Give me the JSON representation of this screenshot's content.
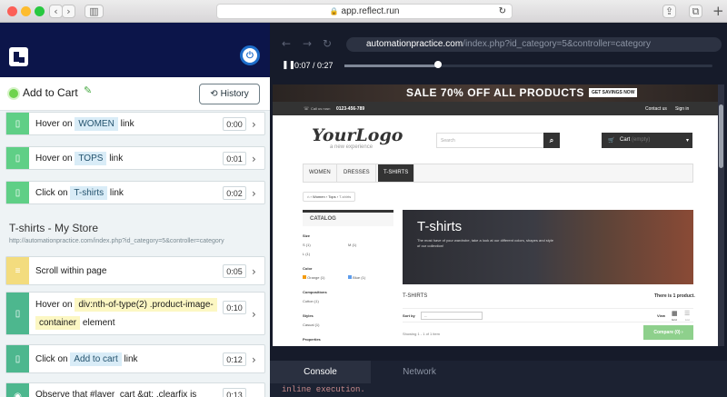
{
  "browser": {
    "address": "app.reflect.run"
  },
  "left": {
    "title": "Add to Cart",
    "history_label": "History",
    "steps": [
      {
        "pre": "Hover on",
        "tag": "WOMEN",
        "post": "link",
        "time": "0:00"
      },
      {
        "pre": "Hover on",
        "tag": "TOPS",
        "post": "link",
        "time": "0:01"
      },
      {
        "pre": "Click on",
        "tag": "T-shirts",
        "post": "link",
        "time": "0:02"
      }
    ],
    "page_title": "T-shirts - My Store",
    "page_url": "http://automationpractice.com/index.php?id_category=5&controller=category",
    "steps2": [
      {
        "text": "Scroll within page",
        "time": "0:05"
      },
      {
        "pre": "Hover on",
        "tag": "div:nth-of-type(2) .product-image-",
        "tag2": "container",
        "post": "element",
        "time": "0:10"
      },
      {
        "pre": "Click on",
        "tag": "Add to cart",
        "post": "link",
        "time": "0:12"
      },
      {
        "text": "Observe that #layer_cart &gt; .clearfix is",
        "time": "0:13"
      }
    ]
  },
  "right": {
    "url_host": "automationpractice.com",
    "url_path": "/index.php?id_category=5&controller=category",
    "time": "0:07 / 0:27",
    "progress": 0.26,
    "site": {
      "banner": "SALE 70% OFF ALL PRODUCTS",
      "banner_btn": "GET SAVINGS NOW",
      "call": "Call us now:",
      "phone": "0123-456-789",
      "contact": "Contact us",
      "signin": "Sign in",
      "logo": "YourLogo",
      "logo_sub": "a new experience",
      "search_ph": "Search",
      "cart": "Cart",
      "cart_empty": "(empty)",
      "menu": [
        "WOMEN",
        "DRESSES",
        "T-SHIRTS"
      ],
      "breadcrumb": [
        "Women",
        "Tops",
        "T-shirts"
      ],
      "catalog": "CATALOG",
      "filters": [
        {
          "label": "Size",
          "items": [
            "S (1)",
            "M (1)",
            "L (1)"
          ]
        },
        {
          "label": "Color",
          "items": [
            "Orange (1)",
            "Blue (1)"
          ]
        },
        {
          "label": "Compositions",
          "items": [
            "Cotton (1)"
          ]
        },
        {
          "label": "Styles",
          "items": [
            "Casual (1)"
          ]
        },
        {
          "label": "Properties",
          "items": []
        }
      ],
      "hero_title": "T-shirts",
      "hero_text": "The most have of your wardrobe, take a look at our different colors, shapes and style of our collection!",
      "section": "T-SHIRTS",
      "count": "There is 1 product.",
      "sort_label": "Sort by",
      "sort_value": "--",
      "view_label": "View",
      "view_grid": "Grid",
      "view_list": "List",
      "showing": "Showing 1 - 1 of 1 item",
      "compare": "Compare (0)"
    },
    "tabs": [
      "Console",
      "Network"
    ],
    "console_text": "inline execution."
  }
}
